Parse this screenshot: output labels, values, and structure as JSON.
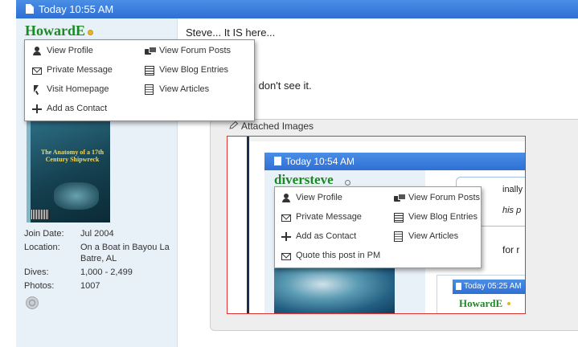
{
  "post": {
    "time": "Today 10:55 AM",
    "username": "HowardE",
    "message_line1": "Steve... It IS here...",
    "message_line2": "you don't see it.",
    "attached_images_label": "Attached Images"
  },
  "avatar": {
    "cover_title": "The Anatomy of a 17th Century Shipwreck"
  },
  "user_info": [
    {
      "key": "Join Date:",
      "value": "Jul 2004"
    },
    {
      "key": "Location:",
      "value": "On a Boat in Bayou La Batre, AL"
    },
    {
      "key": "Dives:",
      "value": "1,000 - 2,499"
    },
    {
      "key": "Photos:",
      "value": "1007"
    }
  ],
  "user_menu": {
    "left": [
      "View Profile",
      "Private Message",
      "Visit Homepage",
      "Add as Contact"
    ],
    "right": [
      "View Forum Posts",
      "View Blog Entries",
      "View Articles"
    ]
  },
  "thumbnail": {
    "time": "Today 10:54 AM",
    "username": "diversteve",
    "right_text1": "inally",
    "right_text2": "his p",
    "right_text3": "for r",
    "menu_left": [
      "View Profile",
      "Private Message",
      "Add as Contact",
      "Quote this post in PM"
    ],
    "menu_right": [
      "View Forum Posts",
      "View Blog Entries",
      "View Articles"
    ],
    "second_post_time": "Today 05:25 AM",
    "second_post_user": "HowardE"
  },
  "icons": {
    "doc": "document-icon",
    "person": "person-icon",
    "mail": "envelope-icon",
    "cursor": "cursor-icon",
    "plus": "plus-icon",
    "chat": "chat-icon",
    "list": "list-icon",
    "article": "article-icon",
    "pencil": "pencil-icon",
    "globe": "globe-icon"
  },
  "colors": {
    "header_blue": "#3b7edc",
    "username_green": "#1c8a24",
    "sidebar_bg": "#e8f0f8",
    "thumb_border": "#dd3333"
  }
}
